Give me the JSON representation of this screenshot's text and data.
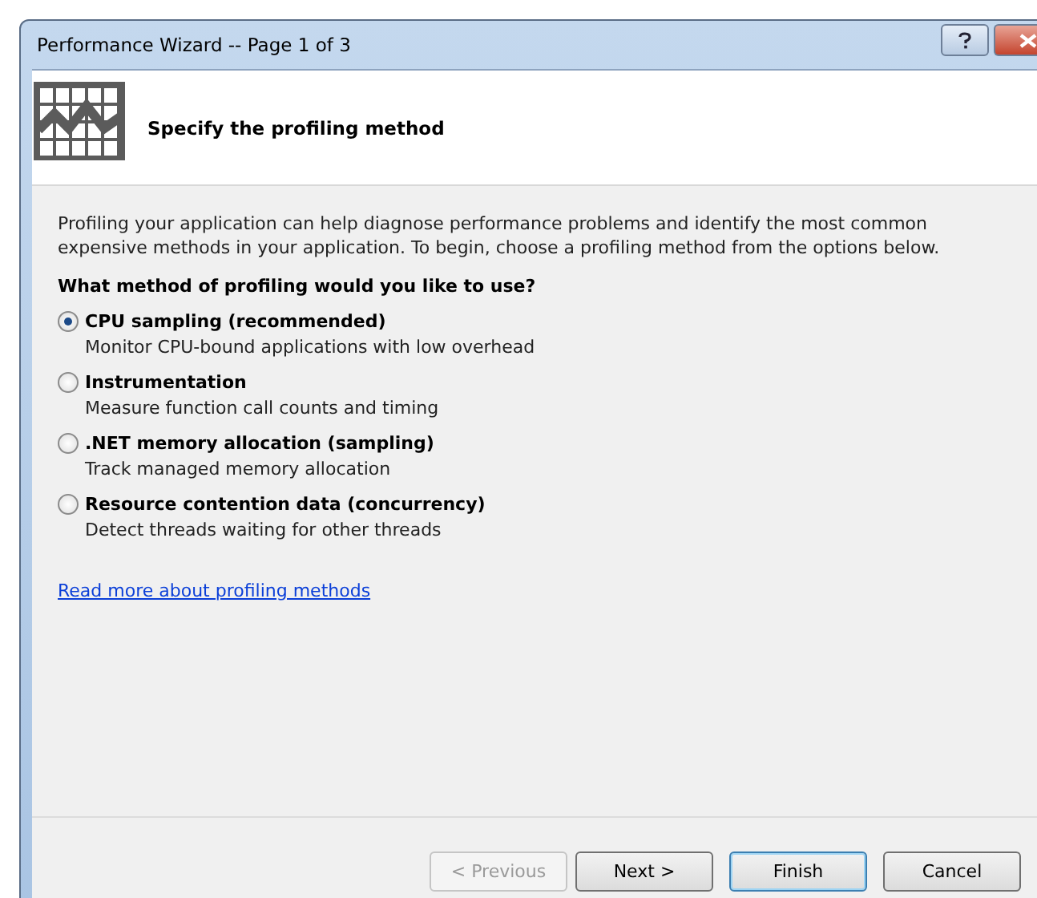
{
  "window": {
    "title": "Performance Wizard -- Page 1 of 3"
  },
  "header": {
    "title": "Specify the profiling method"
  },
  "intro": "Profiling your application can help diagnose performance problems and identify the most common expensive methods in your application. To begin, choose a profiling method from the options below.",
  "question": "What method of profiling would you like to use?",
  "options": [
    {
      "label": "CPU sampling (recommended)",
      "description": "Monitor CPU-bound applications with low overhead",
      "selected": true
    },
    {
      "label": "Instrumentation",
      "description": "Measure function call counts and timing",
      "selected": false
    },
    {
      "label": ".NET memory allocation (sampling)",
      "description": "Track managed memory allocation",
      "selected": false
    },
    {
      "label": "Resource contention data (concurrency)",
      "description": "Detect threads waiting for other threads",
      "selected": false
    }
  ],
  "link": "Read more about profiling methods",
  "buttons": [
    {
      "label": "< Previous",
      "disabled": true,
      "default": false
    },
    {
      "label": "Next >",
      "disabled": false,
      "default": false
    },
    {
      "label": "Finish",
      "disabled": false,
      "default": true
    },
    {
      "label": "Cancel",
      "disabled": false,
      "default": false
    }
  ]
}
